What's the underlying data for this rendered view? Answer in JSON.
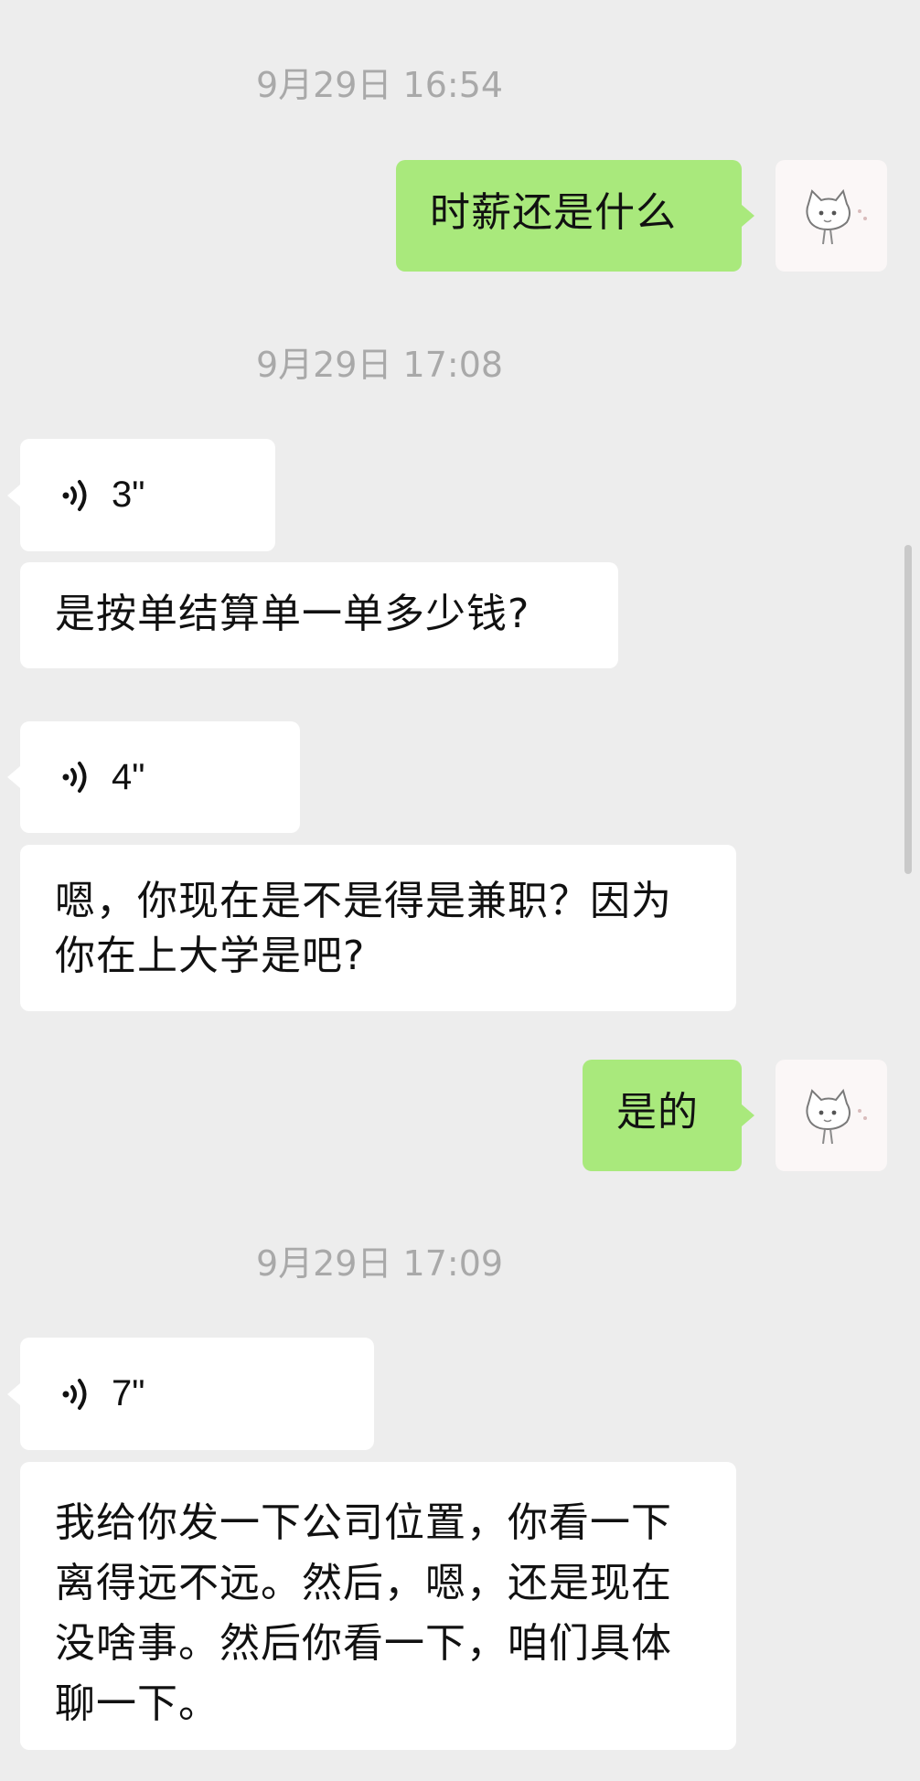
{
  "chat": {
    "timestamps": [
      "9月29日 16:54",
      "9月29日 17:08",
      "9月29日 17:09"
    ],
    "messages": [
      {
        "type": "text",
        "side": "outgoing",
        "text": "时薪还是什么"
      },
      {
        "type": "voice",
        "side": "incoming",
        "duration": "3\""
      },
      {
        "type": "transcript",
        "side": "incoming",
        "text": "是按单结算单一单多少钱?"
      },
      {
        "type": "voice",
        "side": "incoming",
        "duration": "4\""
      },
      {
        "type": "transcript",
        "side": "incoming",
        "text": "嗯，你现在是不是得是兼职？因为你在上大学是吧?"
      },
      {
        "type": "text",
        "side": "outgoing",
        "text": "是的"
      },
      {
        "type": "voice",
        "side": "incoming",
        "duration": "7\""
      },
      {
        "type": "transcript",
        "side": "incoming",
        "text": "我给你发一下公司位置，你看一下离得远不远。然后，嗯，还是现在没啥事。然后你看一下，咱们具体聊一下。"
      }
    ]
  },
  "icons": {
    "voice": "voice-wave-icon",
    "avatar": "cat-avatar-icon"
  },
  "colors": {
    "background": "#ededed",
    "outgoing_bubble": "#a9e97c",
    "incoming_bubble": "#ffffff",
    "timestamp_text": "#a9a9a9"
  }
}
